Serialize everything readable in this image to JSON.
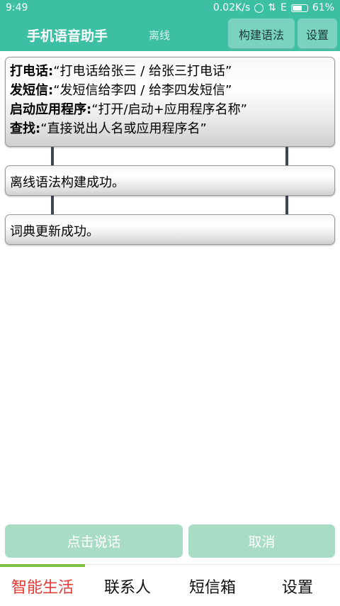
{
  "status_bar": {
    "time": "9:49",
    "network_speed": "0.02K/s",
    "network_type": "E",
    "battery": "61%"
  },
  "header": {
    "title": "手机语音助手",
    "mode": "离线",
    "build_grammar_label": "构建语法",
    "settings_label": "设置",
    "accent_color": "#3dbfa4"
  },
  "help": [
    {
      "key": "打电话:",
      "value": "“打电话给张三 / 给张三打电话”"
    },
    {
      "key": "发短信:",
      "value": "“发短信给李四 / 给李四发短信”"
    },
    {
      "key": "启动应用程序:",
      "value": "“打开/启动+应用程序名称”"
    },
    {
      "key": "查找:",
      "value": "“直接说出人名或应用程序名”"
    }
  ],
  "messages": [
    "离线语法构建成功。",
    "词典更新成功。"
  ],
  "actions": {
    "speak_label": "点击说话",
    "cancel_label": "取消"
  },
  "tabs": [
    {
      "label": "智能生活",
      "active": true
    },
    {
      "label": "联系人",
      "active": false
    },
    {
      "label": "短信箱",
      "active": false
    },
    {
      "label": "设置",
      "active": false
    }
  ]
}
